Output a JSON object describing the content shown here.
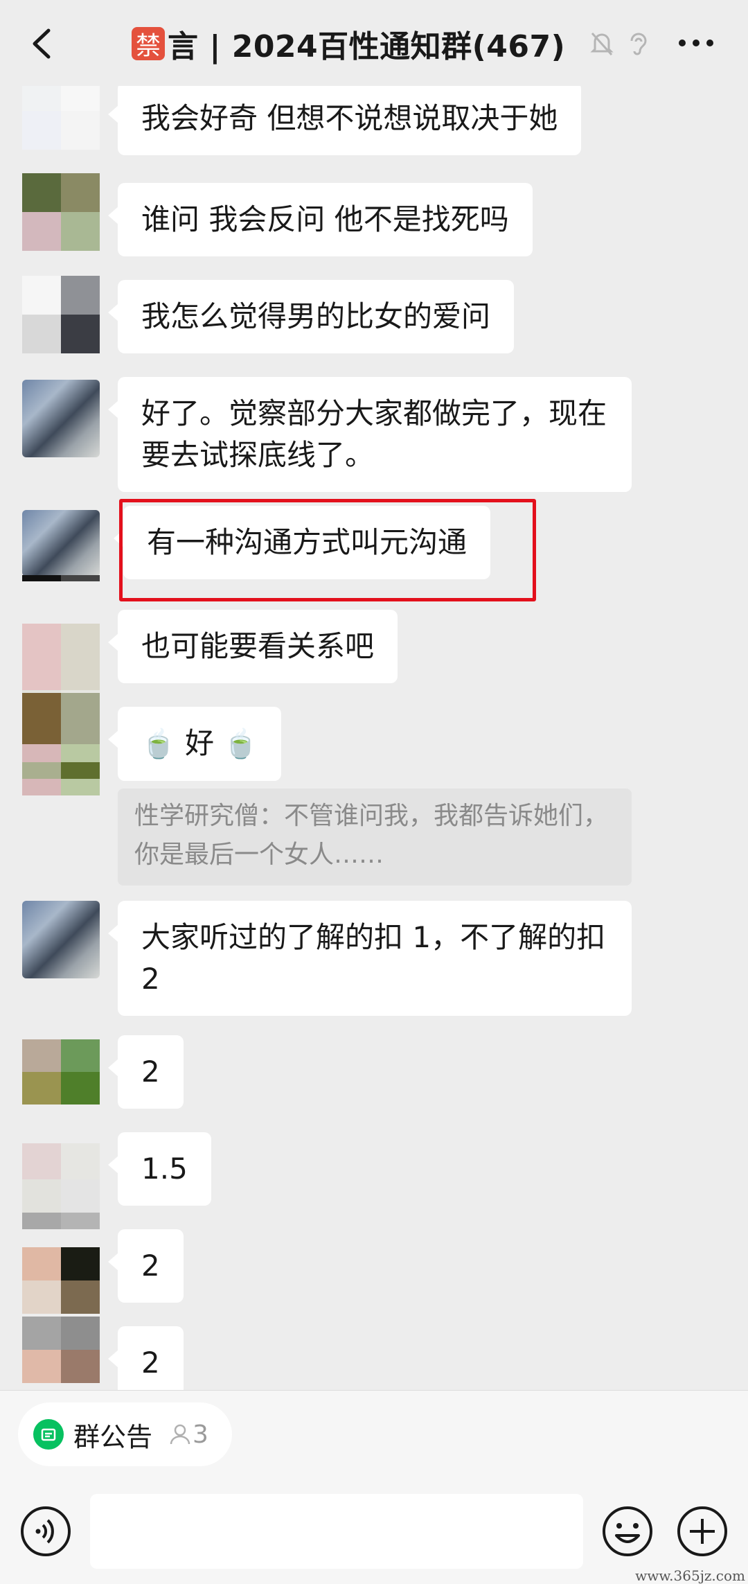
{
  "header": {
    "ban_badge": "禁",
    "title": "言 | 2024百性通知群(467)",
    "mute_icon": "bell-off-icon",
    "ear_icon": "ear-icon",
    "more_icon": "more-icon"
  },
  "messages": [
    {
      "text": "我会好奇 但想不说想说取决于她"
    },
    {
      "text": "谁问 我会反问 他不是找死吗"
    },
    {
      "text": "我怎么觉得男的比女的爱问"
    },
    {
      "text": "好了。觉察部分大家都做完了，现在要去试探底线了。"
    },
    {
      "text": "有一种沟通方式叫元沟通"
    },
    {
      "text": "也可能要看关系吧"
    },
    {
      "text": "好",
      "emoji": "🍵"
    },
    {
      "text": "大家听过的了解的扣 1，不了解的扣 2"
    },
    {
      "text": "2"
    },
    {
      "text": "1.5"
    },
    {
      "text": "2"
    },
    {
      "text": "2"
    }
  ],
  "quote": {
    "text": "性学研究僧：不管谁问我，我都告诉她们，你是最后一个女人……"
  },
  "announcement": {
    "label": "群公告",
    "count": "3"
  },
  "input": {
    "placeholder": ""
  },
  "watermark": "www.365jz.com",
  "colors": {
    "background": "#ededed",
    "bubble": "#ffffff",
    "highlight": "#e3101c",
    "accent": "#07c160",
    "badge": "#e4513d"
  }
}
